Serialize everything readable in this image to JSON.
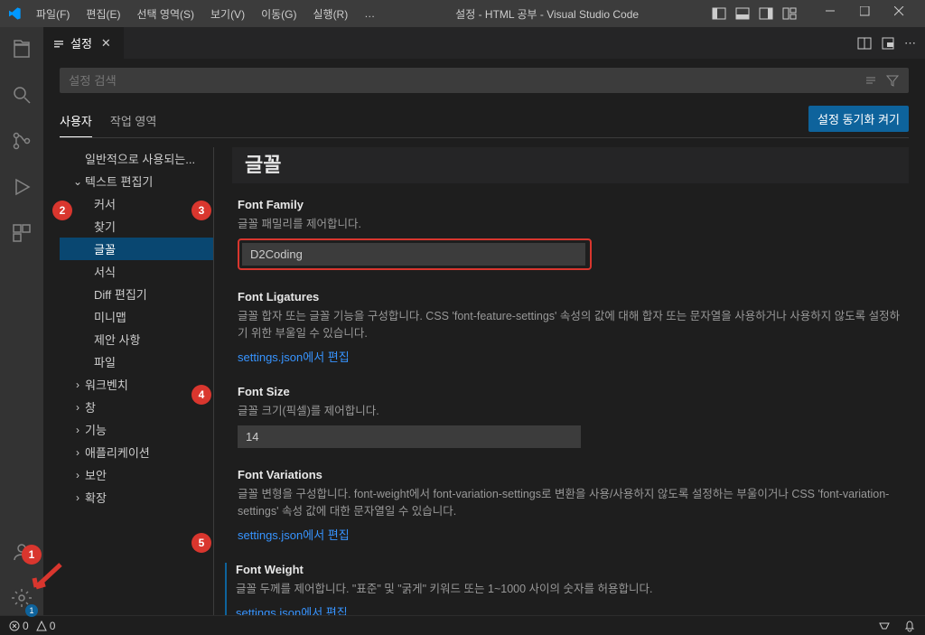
{
  "titlebar": {
    "menu": [
      "파일(F)",
      "편집(E)",
      "선택 영역(S)",
      "보기(V)",
      "이동(G)",
      "실행(R)",
      "…"
    ],
    "title": "설정 - HTML 공부 - Visual Studio Code"
  },
  "tab": {
    "label": "설정"
  },
  "search": {
    "placeholder": "설정 검색"
  },
  "scope": {
    "user": "사용자",
    "workspace": "작업 영역"
  },
  "sync_button": "설정 동기화 켜기",
  "tree": {
    "commonly_used": "일반적으로 사용되는...",
    "text_editor": "텍스트 편집기",
    "sub": {
      "cursor": "커서",
      "find": "찾기",
      "font": "글꼴",
      "format": "서식",
      "diff": "Diff 편집기",
      "minimap": "미니맵",
      "suggestion": "제안 사항",
      "file": "파일"
    },
    "parents": {
      "workbench": "워크벤치",
      "window": "창",
      "features": "기능",
      "application": "애플리케이션",
      "security": "보안",
      "extensions": "확장"
    }
  },
  "detail": {
    "section": "글꼴",
    "font_family": {
      "label": "Font Family",
      "desc": "글꼴 패밀리를 제어합니다.",
      "value": "D2Coding"
    },
    "font_ligatures": {
      "label": "Font Ligatures",
      "desc": "글꼴 합자 또는 글꼴 기능을 구성합니다. CSS 'font-feature-settings' 속성의 값에 대해 합자 또는 문자열을 사용하거나 사용하지 않도록 설정하기 위한 부울일 수 있습니다.",
      "link": "settings.json에서 편집"
    },
    "font_size": {
      "label": "Font Size",
      "desc": "글꼴 크기(픽셀)를 제어합니다.",
      "value": "14"
    },
    "font_variations": {
      "label": "Font Variations",
      "desc": "글꼴 변형을 구성합니다. font-weight에서 font-variation-settings로 변환을 사용/사용하지 않도록 설정하는 부울이거나 CSS 'font-variation-settings' 속성 값에 대한 문자열일 수 있습니다.",
      "link": "settings.json에서 편집"
    },
    "font_weight": {
      "label": "Font Weight",
      "desc": "글꼴 두께를 제어합니다. \"표준\" 및 \"굵게\" 키워드 또는 1~1000 사이의 숫자를 허용합니다.",
      "link": "settings.json에서 편집"
    }
  },
  "statusbar": {
    "errors": "0",
    "warnings": "0"
  },
  "markers": {
    "m1": "1",
    "m2": "2",
    "m3": "3",
    "m4": "4",
    "m5": "5"
  }
}
